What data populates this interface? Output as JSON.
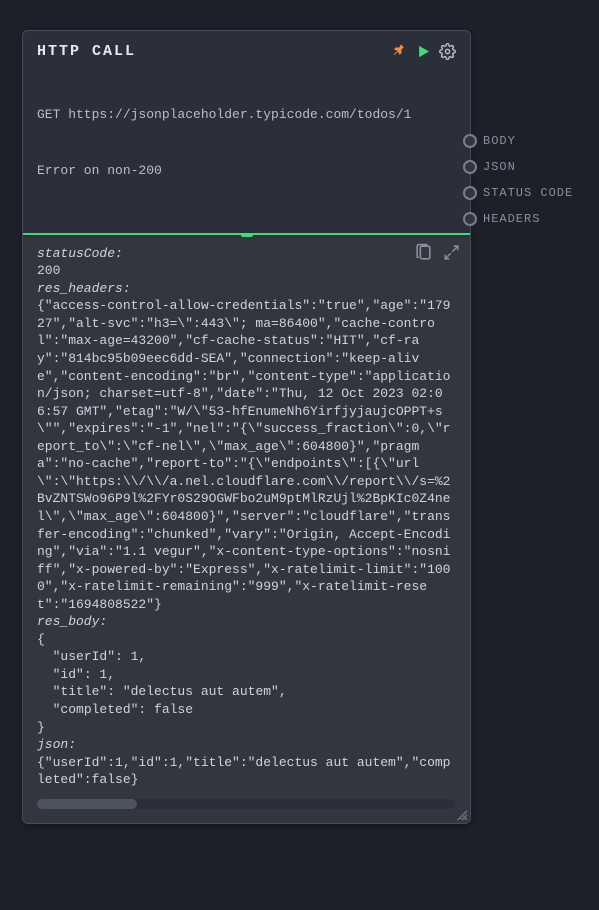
{
  "title": "HTTP CALL",
  "upper": {
    "line1": "GET https://jsonplaceholder.typicode.com/todos/1",
    "line2": "Error on non-200"
  },
  "ports": [
    {
      "label": "BODY"
    },
    {
      "label": "JSON"
    },
    {
      "label": "STATUS CODE"
    },
    {
      "label": "HEADERS"
    }
  ],
  "labels": {
    "statusCode": "statusCode:",
    "resHeaders": "res_headers:",
    "resBody": "res_body:",
    "json": "json:"
  },
  "statusCode": "200",
  "resHeaders": "{\"access-control-allow-credentials\":\"true\",\"age\":\"17927\",\"alt-svc\":\"h3=\\\":443\\\"; ma=86400\",\"cache-control\":\"max-age=43200\",\"cf-cache-status\":\"HIT\",\"cf-ray\":\"814bc95b09eec6dd-SEA\",\"connection\":\"keep-alive\",\"content-encoding\":\"br\",\"content-type\":\"application/json; charset=utf-8\",\"date\":\"Thu, 12 Oct 2023 02:06:57 GMT\",\"etag\":\"W/\\\"53-hfEnumeNh6YirfjyjaujcOPPT+s\\\"\",\"expires\":\"-1\",\"nel\":\"{\\\"success_fraction\\\":0,\\\"report_to\\\":\\\"cf-nel\\\",\\\"max_age\\\":604800}\",\"pragma\":\"no-cache\",\"report-to\":\"{\\\"endpoints\\\":[{\\\"url\\\":\\\"https:\\\\/\\\\/a.nel.cloudflare.com\\\\/report\\\\/s=%2BvZNTSWo96P9l%2FYr0S29OGWFbo2uM9ptMlRzUjl%2BpKIc0Z4nel\\\",\\\"max_age\\\":604800}\",\"server\":\"cloudflare\",\"transfer-encoding\":\"chunked\",\"vary\":\"Origin, Accept-Encoding\",\"via\":\"1.1 vegur\",\"x-content-type-options\":\"nosniff\",\"x-powered-by\":\"Express\",\"x-ratelimit-limit\":\"1000\",\"x-ratelimit-remaining\":\"999\",\"x-ratelimit-reset\":\"1694808522\"}",
  "resBody": "{\n  \"userId\": 1,\n  \"id\": 1,\n  \"title\": \"delectus aut autem\",\n  \"completed\": false\n}",
  "json": "{\"userId\":1,\"id\":1,\"title\":\"delectus aut autem\",\"completed\":false}"
}
